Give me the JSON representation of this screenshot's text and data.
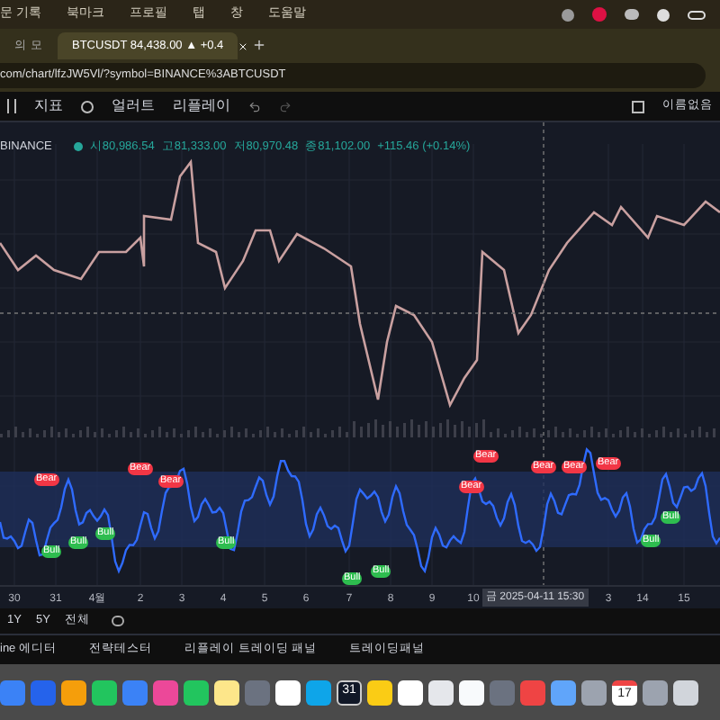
{
  "menu_bar": {
    "items": [
      "문 기록",
      "북마크",
      "프로필",
      "탭",
      "창",
      "도움말"
    ]
  },
  "tabs": [
    {
      "label": "의 모",
      "selected": false
    },
    {
      "label": "BTCUSDT 84,438.00 ▲ +0.4",
      "selected": true
    }
  ],
  "address_bar": {
    "url": "com/chart/lfzJW5Vl/?symbol=BINANCE%3ABTCUSDT"
  },
  "toolbar": {
    "items": [
      "지표",
      "얼러트",
      "리플레이"
    ],
    "layout_name": "이름없음"
  },
  "legend": {
    "exchange": "BINANCE",
    "open": "시80,986.54",
    "high": "고81,333.00",
    "low": "저80,970.48",
    "close": "종81,102.00",
    "change": "+115.46 (+0.14%)"
  },
  "signals": [
    {
      "kind": "bear",
      "label": "Bear"
    },
    {
      "kind": "bear",
      "label": "Bear"
    },
    {
      "kind": "bear",
      "label": "Bear"
    },
    {
      "kind": "bear",
      "label": "Bear"
    },
    {
      "kind": "bear",
      "label": "Bear"
    },
    {
      "kind": "bear",
      "label": "Bear"
    },
    {
      "kind": "bear",
      "label": "Bear"
    },
    {
      "kind": "bear",
      "label": "Bear"
    },
    {
      "kind": "bull",
      "label": "Bull"
    },
    {
      "kind": "bull",
      "label": "Bull"
    },
    {
      "kind": "bull",
      "label": "Bull"
    },
    {
      "kind": "bull",
      "label": "Bull"
    },
    {
      "kind": "bull",
      "label": "Bull"
    },
    {
      "kind": "bull",
      "label": "Bull"
    },
    {
      "kind": "bull",
      "label": "Bull"
    },
    {
      "kind": "bull",
      "label": "Bull"
    }
  ],
  "time_axis": {
    "labels": [
      "30",
      "31",
      "4월",
      "2",
      "3",
      "4",
      "5",
      "6",
      "7",
      "8",
      "9",
      "10",
      "3",
      "14",
      "15"
    ],
    "crosshair_label": "금 2025-04-11   15:30"
  },
  "ranges": [
    "1Y",
    "5Y",
    "전체"
  ],
  "bottom_tabs": [
    "ine 에디터",
    "전략테스터",
    "리플레이 트레이딩 패널",
    "트레이딩패널"
  ],
  "dock": {
    "notion_calendar_day": "31",
    "calendar_day": "17"
  }
}
